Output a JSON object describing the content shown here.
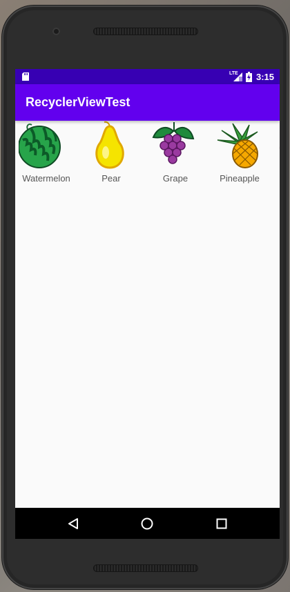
{
  "status_bar": {
    "network_label": "LTE",
    "time": "3:15"
  },
  "app_bar": {
    "title": "RecyclerViewTest"
  },
  "fruits": [
    {
      "name": "Watermelon",
      "icon": "watermelon-icon"
    },
    {
      "name": "Pear",
      "icon": "pear-icon"
    },
    {
      "name": "Grape",
      "icon": "grape-icon"
    },
    {
      "name": "Pineapple",
      "icon": "pineapple-icon"
    },
    {
      "name": "",
      "icon": "strawberry-icon"
    }
  ],
  "nav_bar": {
    "buttons": [
      "back-icon",
      "home-icon",
      "recents-icon"
    ]
  },
  "colors": {
    "status_bar": "#3700b3",
    "app_bar": "#6200ee",
    "background": "#fafafa"
  }
}
